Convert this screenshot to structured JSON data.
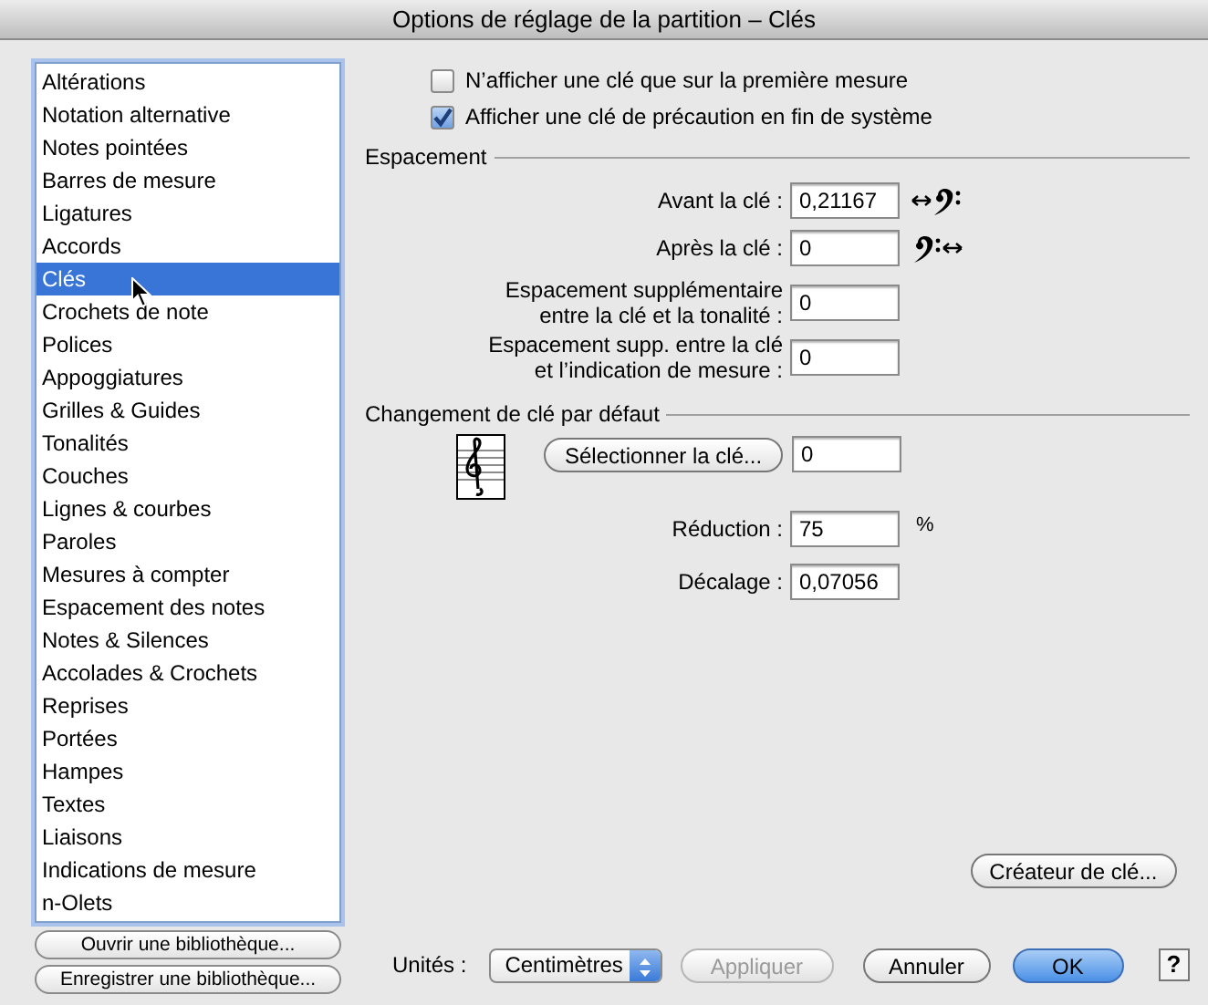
{
  "window": {
    "title": "Options de réglage de la partition – Clés"
  },
  "sidebar": {
    "items": [
      {
        "label": "Altérations",
        "selected": false
      },
      {
        "label": "Notation alternative",
        "selected": false
      },
      {
        "label": "Notes pointées",
        "selected": false
      },
      {
        "label": "Barres de mesure",
        "selected": false
      },
      {
        "label": "Ligatures",
        "selected": false
      },
      {
        "label": "Accords",
        "selected": false
      },
      {
        "label": "Clés",
        "selected": true
      },
      {
        "label": "Crochets de note",
        "selected": false
      },
      {
        "label": "Polices",
        "selected": false
      },
      {
        "label": "Appoggiatures",
        "selected": false
      },
      {
        "label": "Grilles & Guides",
        "selected": false
      },
      {
        "label": "Tonalités",
        "selected": false
      },
      {
        "label": "Couches",
        "selected": false
      },
      {
        "label": "Lignes & courbes",
        "selected": false
      },
      {
        "label": "Paroles",
        "selected": false
      },
      {
        "label": "Mesures à compter",
        "selected": false
      },
      {
        "label": "Espacement des notes",
        "selected": false
      },
      {
        "label": "Notes & Silences",
        "selected": false
      },
      {
        "label": "Accolades & Crochets",
        "selected": false
      },
      {
        "label": "Reprises",
        "selected": false
      },
      {
        "label": "Portées",
        "selected": false
      },
      {
        "label": "Hampes",
        "selected": false
      },
      {
        "label": "Textes",
        "selected": false
      },
      {
        "label": "Liaisons",
        "selected": false
      },
      {
        "label": "Indications de mesure",
        "selected": false
      },
      {
        "label": "n-Olets",
        "selected": false
      }
    ],
    "buttons": [
      "Ouvrir une bibliothèque...",
      "Enregistrer une bibliothèque..."
    ]
  },
  "options": [
    {
      "label": "N’afficher une clé que sur la première mesure",
      "checked": false
    },
    {
      "label": "Afficher une clé de précaution en fin de système",
      "checked": true
    }
  ],
  "spacing": {
    "title": "Espacement",
    "fields": [
      {
        "label": "Avant la clé :",
        "value": "0,21167",
        "kind": "before"
      },
      {
        "label": "Après la clé :",
        "value": "0",
        "kind": "after"
      },
      {
        "label": "Espacement supplémentaire\nentre la clé et la tonalité :",
        "value": "0",
        "kind": "plain"
      },
      {
        "label": "Espacement supp. entre la clé\net l’indication de mesure :",
        "value": "0",
        "kind": "plain"
      }
    ]
  },
  "default_clef": {
    "title": "Changement de clé par défaut",
    "button": "Sélectionner la clé...",
    "value": "0",
    "fields": [
      {
        "label": "Réduction :",
        "value": "75",
        "unit": "%"
      },
      {
        "label": "Décalage :",
        "value": "0,07056"
      }
    ]
  },
  "clef_creator_button": "Créateur de clé...",
  "footer": {
    "units_label": "Unités :",
    "units": "Centimètres",
    "buttons": [
      {
        "label": "Appliquer",
        "disabled": true,
        "default": false
      },
      {
        "label": "Annuler",
        "disabled": false,
        "default": false
      },
      {
        "label": "OK",
        "disabled": false,
        "default": true
      }
    ],
    "help": "?"
  }
}
